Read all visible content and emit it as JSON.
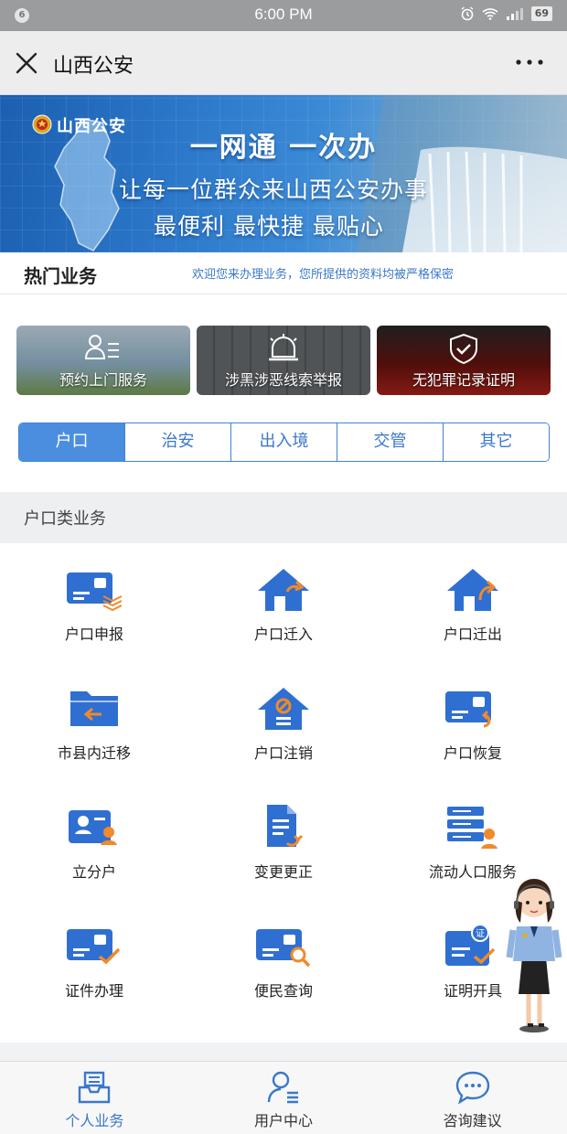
{
  "status_bar": {
    "badge": "6",
    "time": "6:00 PM",
    "battery": "69"
  },
  "title_bar": {
    "title": "山西公安"
  },
  "banner": {
    "brand": "山西公安",
    "headline": "一网通 一次办",
    "line2": "让每一位群众来山西公安办事",
    "line3": "最便利 最快捷 最贴心"
  },
  "hot": {
    "title": "热门业务",
    "welcome": "欢迎您来办理业务，您所提供的资料均被严格保密",
    "cards": [
      {
        "label": "预约上门服务",
        "icon": "person-list-icon"
      },
      {
        "label": "涉黑涉恶线索举报",
        "icon": "alarm-light-icon"
      },
      {
        "label": "无犯罪记录证明",
        "icon": "shield-check-icon"
      }
    ]
  },
  "tabs": [
    "户口",
    "治安",
    "出入境",
    "交管",
    "其它"
  ],
  "active_tab": "户口",
  "category": {
    "title": "户口类业务",
    "items": [
      {
        "label": "户口申报",
        "icon": "id-card-layers-icon"
      },
      {
        "label": "户口迁入",
        "icon": "house-arrow-in-icon"
      },
      {
        "label": "户口迁出",
        "icon": "house-arrow-out-icon"
      },
      {
        "label": "市县内迁移",
        "icon": "folder-arrow-icon"
      },
      {
        "label": "户口注销",
        "icon": "house-cancel-icon"
      },
      {
        "label": "户口恢复",
        "icon": "id-card-restore-icon"
      },
      {
        "label": "立分户",
        "icon": "id-card-person-icon"
      },
      {
        "label": "变更更正",
        "icon": "document-refresh-icon"
      },
      {
        "label": "流动人口服务",
        "icon": "list-person-icon"
      },
      {
        "label": "证件办理",
        "icon": "id-card-check-icon"
      },
      {
        "label": "便民查询",
        "icon": "id-card-search-icon"
      },
      {
        "label": "证明开具",
        "icon": "certificate-check-icon"
      }
    ]
  },
  "bottom_nav": [
    {
      "label": "个人业务",
      "icon": "inbox-tray-icon",
      "active": true
    },
    {
      "label": "用户中心",
      "icon": "user-icon",
      "active": false
    },
    {
      "label": "咨询建议",
      "icon": "chat-bubble-icon",
      "active": false
    }
  ],
  "colors": {
    "primary": "#3f83d8",
    "accent_orange": "#f08a2c",
    "icon_blue": "#2f6fd1"
  }
}
